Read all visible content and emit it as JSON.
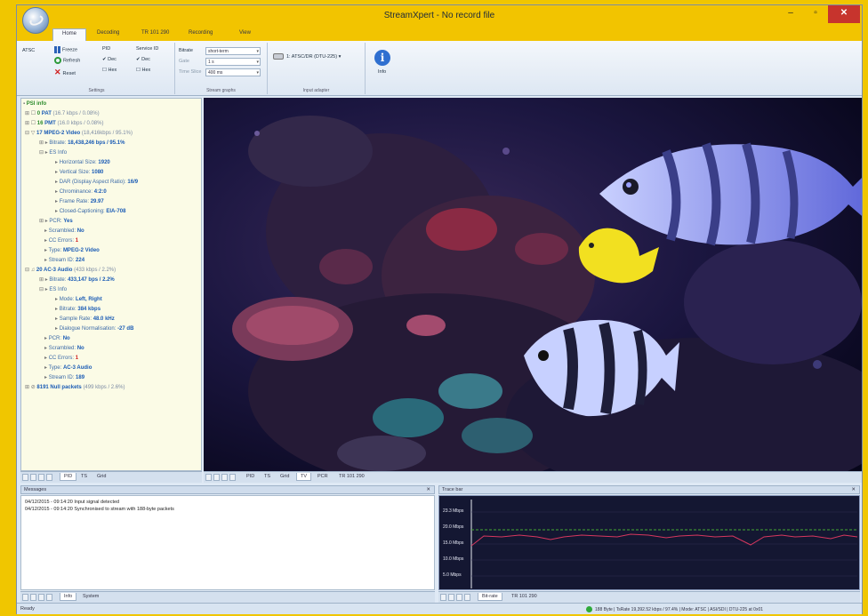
{
  "window": {
    "title": "StreamXpert - No record file",
    "controls": {
      "minimize": "–",
      "maximize": "▫",
      "close": "✕"
    }
  },
  "ribbon_tabs": [
    "Home",
    "Decoding",
    "TR 101 290",
    "Recording",
    "View"
  ],
  "ribbon": {
    "settings": {
      "atsc": "ATSC",
      "freeze": "Freeze",
      "refresh": "Refresh",
      "reset": "Reset",
      "pid": "PID",
      "pid_dec": "Dec",
      "pid_hex": "Hex",
      "label": "Settings"
    },
    "service_id": {
      "title": "Service ID",
      "dec": "Dec",
      "hex": "Hex"
    },
    "stream_graphs": {
      "bitrate_label": "Bitrate",
      "bitrate_value": "short-term",
      "gate_label": "Gate",
      "gate_value": "1 s",
      "time_slice_label": "Time Slice",
      "time_slice_value": "400 ms",
      "label": "Stream graphs"
    },
    "input_adapter": {
      "value": "1: ATSC/DR (DTU-225)",
      "label": "Input adapter"
    },
    "info_label": "Info"
  },
  "tree": {
    "root": "PSI info",
    "nodes": [
      {
        "text": "PAT",
        "meta": "(16.7 kbps / 0.08%)"
      },
      {
        "text": "PMT",
        "meta": "(16.0 kbps / 0.08%)"
      },
      {
        "text": "17  MPEG-2 Video",
        "meta": "(18,416kbps / 95.1%)"
      },
      {
        "label": "Bitrate:",
        "value": "18,438,246 bps / 95.1%"
      },
      {
        "label": "ES Info"
      },
      {
        "label": "Horizontal Size:",
        "value": "1920"
      },
      {
        "label": "Vertical Size:",
        "value": "1080"
      },
      {
        "label": "DAR (Display Aspect Ratio):",
        "value": "16/9"
      },
      {
        "label": "Chrominance:",
        "value": "4:2:0"
      },
      {
        "label": "Frame Rate:",
        "value": "29.97"
      },
      {
        "label": "Closed-Captioning:",
        "value": "EIA-708"
      },
      {
        "label": "PCR:",
        "value": "Yes"
      },
      {
        "label": "Scrambled:",
        "value": "No"
      },
      {
        "label": "CC Errors:",
        "value": "1"
      },
      {
        "label": "Type:",
        "value": "MPEG-2 Video"
      },
      {
        "label": "Stream ID:",
        "value": "224"
      },
      {
        "text": "20  AC-3 Audio",
        "meta": "(433 kbps / 2.2%)"
      },
      {
        "label": "Bitrate:",
        "value": "433,147 bps / 2.2%"
      },
      {
        "label": "ES Info"
      },
      {
        "label": "Mode:",
        "value": "Left, Right"
      },
      {
        "label": "Bitrate:",
        "value": "384 kbps"
      },
      {
        "label": "Sample Rate:",
        "value": "48.0 kHz"
      },
      {
        "label": "Dialogue Normalisation:",
        "value": "-27 dB"
      },
      {
        "label": "PCR:",
        "value": "No"
      },
      {
        "label": "Scrambled:",
        "value": "No"
      },
      {
        "label": "CC Errors:",
        "value": "1"
      },
      {
        "label": "Type:",
        "value": "AC-3 Audio"
      },
      {
        "label": "Stream ID:",
        "value": "189"
      },
      {
        "text": "8191  Null packets",
        "meta": "(499 kbps / 2.6%)"
      }
    ]
  },
  "tree_tabs": [
    "PID",
    "TS",
    "Grid"
  ],
  "video_tabs": [
    "PID",
    "TS",
    "Grid",
    "TV",
    "PCR",
    "TR 101 290"
  ],
  "messages": {
    "title": "Messages",
    "lines": [
      "04/12/2015 - 09:14:20 Input signal detected",
      "04/12/2015 - 09:14:20 Synchronised to stream with 188-byte packets"
    ],
    "tabs": [
      "Info",
      "System"
    ]
  },
  "trace": {
    "title": "Trace bar",
    "y_labels": [
      "23.3 Mbps",
      "20.0 Mbps",
      "15.0 Mbps",
      "10.0 Mbps",
      "5.0 Mbps"
    ],
    "tabs": [
      "Bit-rate",
      "TR 101 290"
    ],
    "colors": {
      "bg": "#141732",
      "line": "#d6375e",
      "trend": "#44aa33"
    }
  },
  "status": {
    "left": "Ready",
    "right": "188 Byte | TsRate 19,392.52 kbps / 97.4% | Mode: ATSC | ASI/SDI | DTU-225 at 0x01"
  }
}
